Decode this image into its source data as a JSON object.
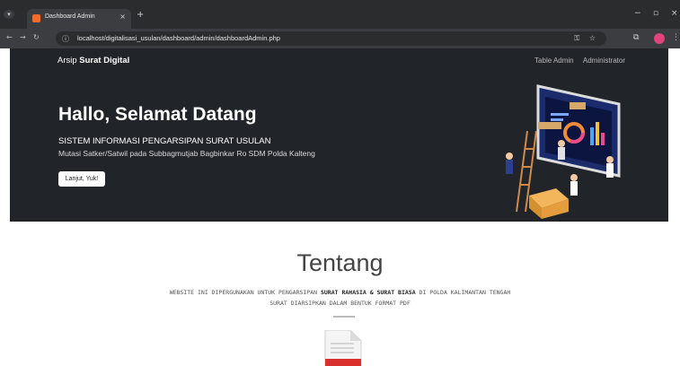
{
  "browser": {
    "tab_title": "Dashboard Admin",
    "url": "localhost/digitalisasi_usulan/dashboard/admin/dashboardAdmin.php"
  },
  "nav": {
    "brand_prefix": "Arsip",
    "brand_bold": "Surat Digital",
    "links": [
      "Table Admin",
      "Administrator"
    ]
  },
  "hero": {
    "title": "Hallo, Selamat Datang",
    "subtitle": "SISTEM INFORMASI PENGARSIPAN SURAT USULAN",
    "description": "Mutasi Satker/Satwil pada Subbagmutjab Bagbinkar Ro SDM Polda Kalteng",
    "button": "Lanjut, Yuk!"
  },
  "about": {
    "title": "Tentang",
    "line1_a": "WEBSITE INI DIPERGUNAKAN UNTUK PENGARSIPAN ",
    "line1_b": "SURAT RAHASIA & SURAT BIASA",
    "line1_c": " DI POLDA KALIMANTAN TENGAH",
    "line2": "SURAT DIARSIPKAN DALAM BENTUK FORMAT PDF"
  },
  "colors": {
    "hero_bg": "#212428",
    "tab_favicon": "#f36a2b",
    "pdf_red": "#d9302c"
  }
}
